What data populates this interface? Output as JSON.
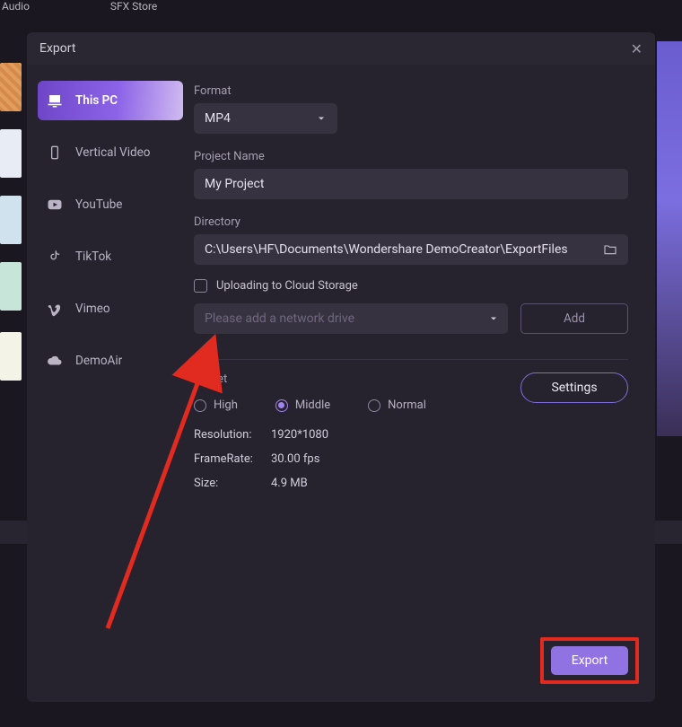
{
  "toolbar": {
    "audio": "Audio",
    "sfx": "SFX Store"
  },
  "modal": {
    "title": "Export",
    "sidebar": [
      {
        "label": "This PC",
        "icon": "monitor"
      },
      {
        "label": "Vertical Video",
        "icon": "phone"
      },
      {
        "label": "YouTube",
        "icon": "youtube"
      },
      {
        "label": "TikTok",
        "icon": "tiktok"
      },
      {
        "label": "Vimeo",
        "icon": "vimeo"
      },
      {
        "label": "DemoAir",
        "icon": "cloud"
      }
    ],
    "format": {
      "label": "Format",
      "value": "MP4"
    },
    "project": {
      "label": "Project Name",
      "value": "My Project"
    },
    "directory": {
      "label": "Directory",
      "value": "C:\\Users\\HF\\Documents\\Wondershare DemoCreator\\ExportFiles"
    },
    "cloud": {
      "checkbox_label": "Uploading to Cloud Storage",
      "placeholder": "Please add a network drive",
      "add_label": "Add"
    },
    "preset": {
      "label": "Preset",
      "settings_label": "Settings",
      "options": {
        "high": "High",
        "middle": "Middle",
        "normal": "Normal"
      },
      "selected": "middle"
    },
    "stats": {
      "resolution": {
        "label": "Resolution:",
        "value": "1920*1080"
      },
      "framerate": {
        "label": "FrameRate:",
        "value": "30.00 fps"
      },
      "size": {
        "label": "Size:",
        "value": "4.9 MB"
      }
    },
    "export_label": "Export"
  },
  "annotation": {
    "highlight_target": "export-button",
    "arrow_color": "#e12a20"
  }
}
